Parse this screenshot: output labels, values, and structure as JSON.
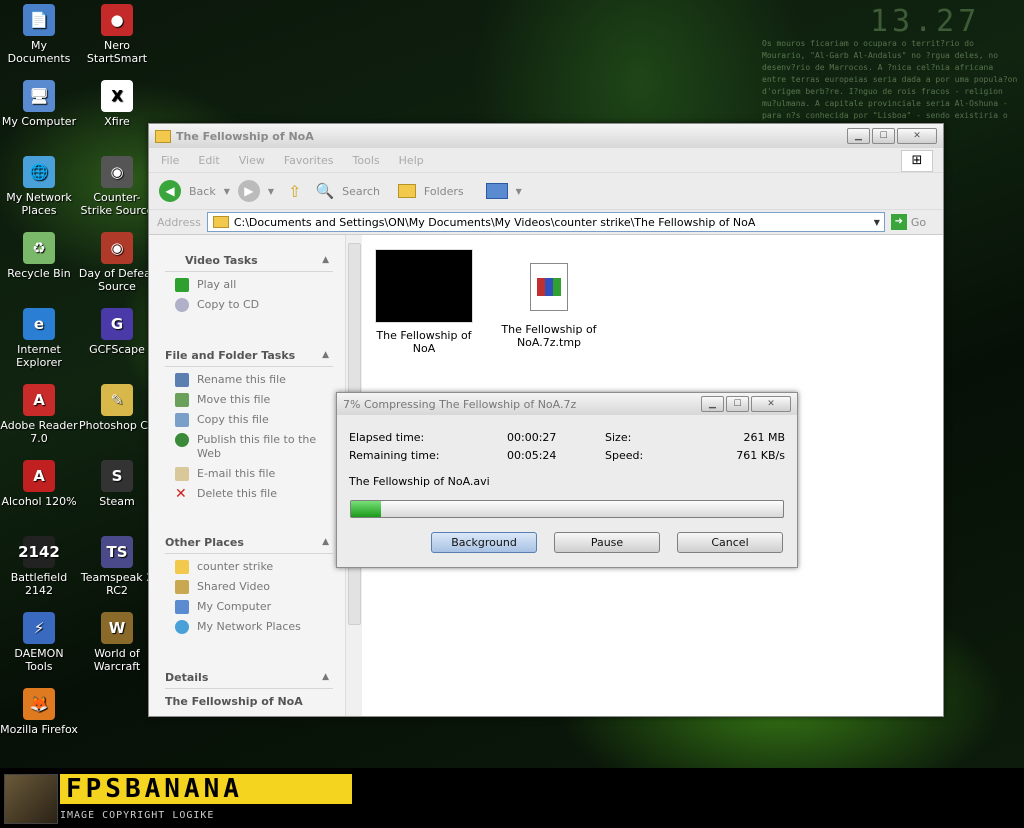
{
  "desktop": {
    "clock_overlay": "13.27",
    "wallpaper_text": "Os mouros ficariam o ocupara o territ?rio do Mourario, \"Al-Garb Al-Andalus\" no ?rgua deles, no desenv?rio de Marrocos. A ?nica cel?nia africana entre terras europeias seria dada a por uma popula?on d'origem berb?re. I?nguo de rois fracos - religion mu?ulmana. A capitale provinciale seria Al-Oshuna - para n?s conhecida por \"Lisboa\" - sendo existiria o emira no meado por Roboto.",
    "icons": [
      {
        "label": "My Documents",
        "color": "#4a7fc9",
        "glyph": "📄"
      },
      {
        "label": "Nero StartSmart",
        "color": "#c52a2a",
        "glyph": "●"
      },
      {
        "label": "My Computer",
        "color": "#5a8bd0",
        "glyph": "🖥"
      },
      {
        "label": "Xfire",
        "color": "#ffffff",
        "glyph": "X"
      },
      {
        "label": "My Network Places",
        "color": "#4aa0d8",
        "glyph": "🌐"
      },
      {
        "label": "Counter-Strike Source",
        "color": "#555555",
        "glyph": "◉"
      },
      {
        "label": "Recycle Bin",
        "color": "#7ab86a",
        "glyph": "♻"
      },
      {
        "label": "Day of Defeat Source",
        "color": "#b03a2a",
        "glyph": "◉"
      },
      {
        "label": "Internet Explorer",
        "color": "#2a7fd4",
        "glyph": "e"
      },
      {
        "label": "GCFScape",
        "color": "#4a3aa8",
        "glyph": "G"
      },
      {
        "label": "Adobe Reader 7.0",
        "color": "#c92a2a",
        "glyph": "A"
      },
      {
        "label": "Photoshop CS",
        "color": "#d8b84a",
        "glyph": "✎"
      },
      {
        "label": "Alcohol 120%",
        "color": "#c02020",
        "glyph": "A"
      },
      {
        "label": "Steam",
        "color": "#333333",
        "glyph": "S"
      },
      {
        "label": "Battlefield 2142",
        "color": "#222222",
        "glyph": "2142"
      },
      {
        "label": "Teamspeak 2 RC2",
        "color": "#4a4a8a",
        "glyph": "TS"
      },
      {
        "label": "DAEMON Tools",
        "color": "#3a6ac0",
        "glyph": "⚡"
      },
      {
        "label": "World of Warcraft",
        "color": "#8a6a2a",
        "glyph": "W"
      },
      {
        "label": "Mozilla Firefox",
        "color": "#e07a20",
        "glyph": "🦊"
      }
    ]
  },
  "explorer": {
    "title": "The Fellowship of NoA",
    "menu": [
      "File",
      "Edit",
      "View",
      "Favorites",
      "Tools",
      "Help"
    ],
    "toolbar": {
      "back": "Back",
      "search": "Search",
      "folders": "Folders"
    },
    "address_label": "Address",
    "address_value": "C:\\Documents and Settings\\ON\\My Documents\\My Videos\\counter strike\\The Fellowship of NoA",
    "go_label": "Go",
    "sections": {
      "video_tasks": {
        "title": "Video Tasks",
        "items": [
          "Play all",
          "Copy to CD"
        ]
      },
      "file_tasks": {
        "title": "File and Folder Tasks",
        "items": [
          "Rename this file",
          "Move this file",
          "Copy this file",
          "Publish this file to the Web",
          "E-mail this file",
          "Delete this file"
        ]
      },
      "other_places": {
        "title": "Other Places",
        "items": [
          "counter strike",
          "Shared Video",
          "My Computer",
          "My Network Places"
        ]
      },
      "details": {
        "title": "Details",
        "name": "The Fellowship of NoA"
      }
    },
    "files": [
      {
        "name": "The Fellowship of NoA"
      },
      {
        "name": "The Fellowship of NoA.7z.tmp"
      }
    ]
  },
  "dialog": {
    "title": "7% Compressing The Fellowship of NoA.7z",
    "elapsed_label": "Elapsed time:",
    "elapsed_value": "00:00:27",
    "remaining_label": "Remaining time:",
    "remaining_value": "00:05:24",
    "size_label": "Size:",
    "size_value": "261 MB",
    "speed_label": "Speed:",
    "speed_value": "761 KB/s",
    "current_file": "The Fellowship of NoA.avi",
    "progress_fraction": 0.07,
    "buttons": {
      "background": "Background",
      "pause": "Pause",
      "cancel": "Cancel"
    }
  },
  "banner": {
    "logo": "FPSBANANA",
    "copyright": "IMAGE COPYRIGHT LOGIKE"
  }
}
